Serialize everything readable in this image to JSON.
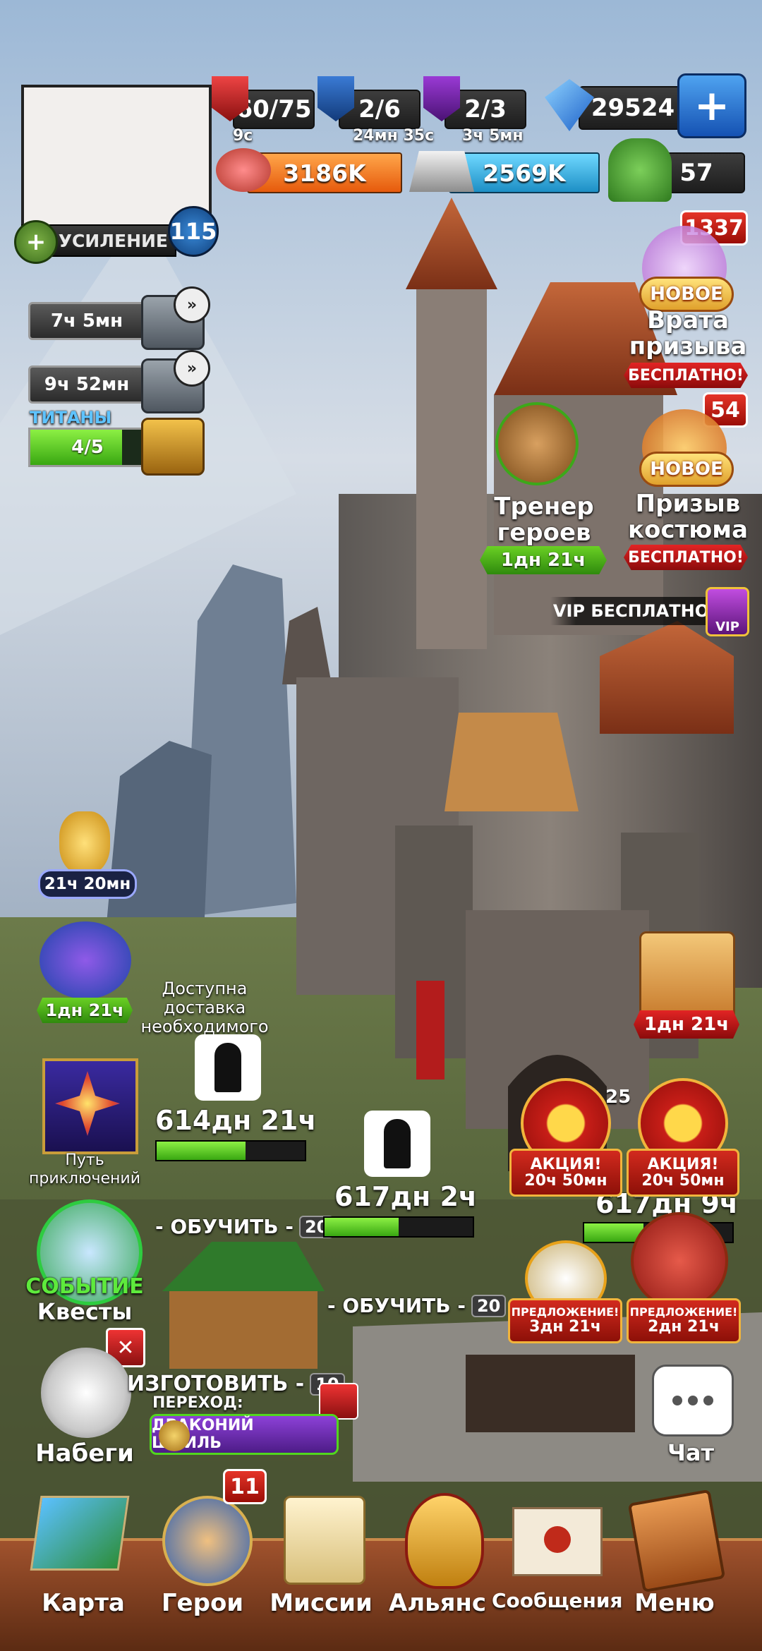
{
  "player": {
    "level": "115",
    "boost_label": "УСИЛЕНИЕ"
  },
  "resources": {
    "raid_tickets": {
      "value": "60/75",
      "timer": "9с"
    },
    "pvp_tickets": {
      "value": "2/6",
      "timer": "24мн 35с"
    },
    "dungeon_tickets": {
      "value": "2/3",
      "timer": "3ч 5мн"
    },
    "gems": "29524",
    "food": "3186K",
    "iron": "2569K",
    "recruits": "57"
  },
  "left_timers": {
    "chest1": "7ч 5мн",
    "chest2": "9ч 52мн",
    "titans_label": "ТИТАНЫ",
    "titans_value": "4/5",
    "titans_fraction": 0.8
  },
  "right_events": {
    "summon_gate": {
      "count": "1337",
      "badge": "НОВОЕ",
      "title": "Врата призыва",
      "free": "БЕСПЛАТНО!"
    },
    "costume": {
      "count": "54",
      "badge": "НОВОЕ",
      "title": "Призыв костюма",
      "free": "БЕСПЛАТНО!"
    },
    "vip": "VIP БЕСПЛАТНО!",
    "vip_icon_label": "VIP",
    "speedup_timer": "1дн 21ч"
  },
  "hero_trainer": {
    "title": "Тренер героев",
    "timer": "1дн 21ч"
  },
  "left_events": {
    "bounty_timer": "21ч 20мн",
    "tome_timer": "1дн 21ч",
    "adventure_label": "Путь приключений",
    "event_label": "СОБЫТИЕ",
    "quests_label": "Квесты",
    "raids_label": "Набеги"
  },
  "city": {
    "delivery_text": "Доступна доставка необходимого",
    "camp1_timer": "614дн 21ч",
    "camp1_progress": 0.6,
    "camp2_timer": "617дн 2ч",
    "camp3_timer": "617дн 9ч",
    "camp2_progress": 0.5,
    "camp3_progress": 0.4,
    "train_label": "- ОБУЧИТЬ -",
    "train_cost": "20",
    "train2_label": "- ОБУЧИТЬ -",
    "train2_cost": "20",
    "craft_label": "ИЗГОТОВИТЬ -",
    "craft_cost": "10",
    "goto_label": "ПЕРЕХОД:",
    "goto_dest": "ДРАКОНИЙ ШПИЛЬ"
  },
  "offers": {
    "sale1": {
      "title": "АКЦИЯ!",
      "timer": "20ч 50мн",
      "count": "25"
    },
    "sale2": {
      "title": "АКЦИЯ!",
      "timer": "20ч 50мн"
    },
    "offer1": {
      "title": "ПРЕДЛОЖЕНИЕ!",
      "timer": "3дн 21ч"
    },
    "offer2": {
      "title": "ПРЕДЛОЖЕНИЕ!",
      "timer": "2дн 21ч"
    }
  },
  "chat_label": "Чат",
  "nav": {
    "heroes_badge": "11",
    "items": [
      {
        "label": "Карта"
      },
      {
        "label": "Герои"
      },
      {
        "label": "Миссии"
      },
      {
        "label": "Альянс"
      },
      {
        "label": "Сообщения"
      },
      {
        "label": "Меню"
      }
    ]
  },
  "colors": {
    "gem_blue": "#2a7de1",
    "food_orange": "#f07a1a",
    "iron_blue": "#2ab4e8",
    "accent_green": "#5ac51e",
    "alert_red": "#d8251b"
  }
}
